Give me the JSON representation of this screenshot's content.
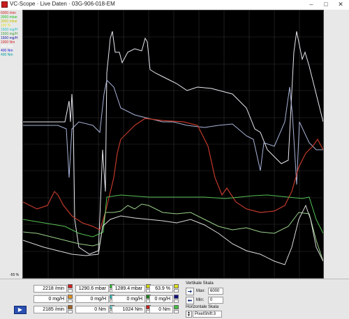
{
  "window": {
    "title": "VC-Scope  ·  Live Daten  ·  03G-906-018-EM",
    "minimize": "–",
    "maximize": "□",
    "close": "✕"
  },
  "left_scale": {
    "labels": [
      {
        "text": "6000 /min",
        "color": "#d02020"
      },
      {
        "text": "3000 mbar",
        "color": "#20c020"
      },
      {
        "text": "3000 mbar",
        "color": "#c0c000"
      },
      {
        "text": "100 %",
        "color": "#e0e020"
      },
      {
        "text": "1500 mg/H",
        "color": "#20c0c0"
      },
      {
        "text": "1500 mg/H",
        "color": "#40a040"
      },
      {
        "text": "1500 mg/H",
        "color": "#1010a0"
      },
      {
        "text": "1000 Nm",
        "color": "#d02020"
      },
      {
        "text": "400 Nm",
        "color": "#ffffff"
      },
      {
        "text": "400 Nm",
        "color": "#2020d0"
      },
      {
        "text": "400 Nm",
        "color": "#00a0a0"
      }
    ],
    "bottom_label": "-55 %"
  },
  "controls": {
    "rows": [
      [
        {
          "value": "2218 /min",
          "chip": "#d02020"
        },
        {
          "value": "1290.6 mbar",
          "chip": "#20c020"
        },
        {
          "value": "1289.4 mbar",
          "chip": "#d0d000"
        },
        {
          "value": "63.9 %",
          "chip": "#e0e020"
        }
      ],
      [
        {
          "value": "0 mg/H",
          "chip": "#e09020"
        },
        {
          "value": "0 mg/H",
          "chip": "#20c0c0"
        },
        {
          "value": "0 mg/H",
          "chip": "#208020"
        },
        {
          "value": "0 mg/H",
          "chip": "#101080"
        }
      ],
      [
        {
          "value": "2185 /min",
          "chip": "#a06020"
        },
        {
          "value": "0 Nm",
          "chip": "#60d0d0"
        },
        {
          "value": "1024 Nm",
          "chip": "#c02020"
        },
        {
          "value": "0 Nm",
          "chip": "#40c040"
        }
      ]
    ],
    "vertical_scale": {
      "title": "Vertikale Skala",
      "max_label": "Max:",
      "max_value": "6000",
      "min_label": "Min:",
      "min_value": "0"
    },
    "horizontal_scale": {
      "title": "Horizontale Skala",
      "pixelshift": "PixelShift:3"
    },
    "play_symbol": "▶"
  }
}
